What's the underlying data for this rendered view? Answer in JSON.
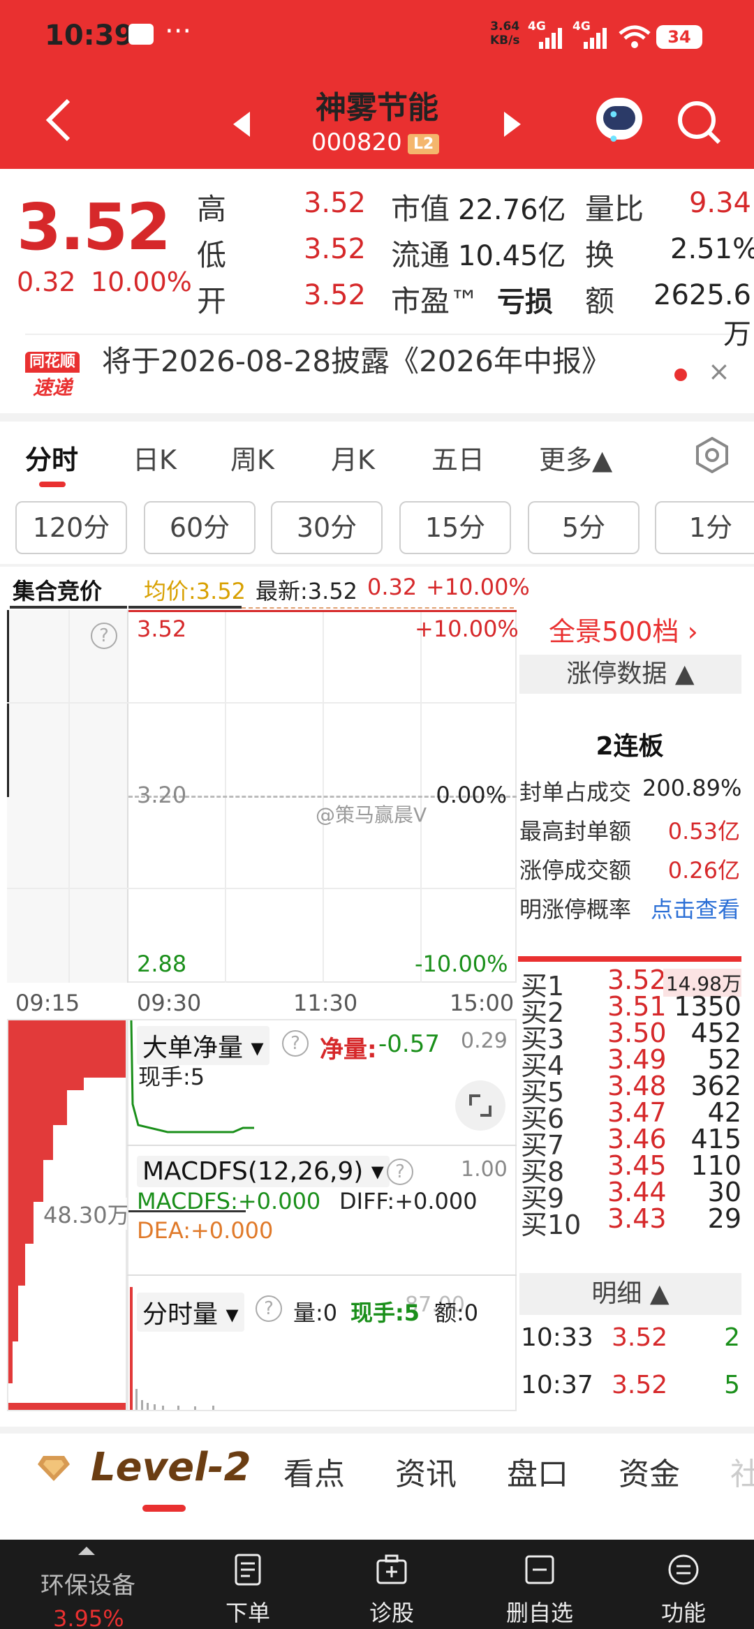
{
  "status": {
    "time": "10:39",
    "net_speed_top": "3.64",
    "net_speed_bottom": "KB/s",
    "signal_a": "4G",
    "signal_b": "4G",
    "battery": "34",
    "dots": "···"
  },
  "header": {
    "title": "神雾节能",
    "code": "000820",
    "badge": "L2"
  },
  "quote": {
    "price": "3.52",
    "change": "0.32",
    "change_pct": "10.00%",
    "high_label": "高",
    "high": "3.52",
    "low_label": "低",
    "low": "3.52",
    "open_label": "开",
    "open": "3.52",
    "mktcap_label": "市值",
    "mktcap": "22.76亿",
    "float_label": "流通",
    "float": "10.45亿",
    "pe_label": "市盈™",
    "pe": "亏损",
    "volratio_label": "量比",
    "volratio": "9.34",
    "turnover_label": "换",
    "turnover": "2.51%",
    "amount_label": "额",
    "amount": "2625.6万"
  },
  "news": {
    "logo_top": "同花顺",
    "logo_bottom": "速递",
    "text": "将于2026-08-28披露《2026年中报》",
    "close": "×"
  },
  "tabs": [
    {
      "label": "分时"
    },
    {
      "label": "日K"
    },
    {
      "label": "周K"
    },
    {
      "label": "月K"
    },
    {
      "label": "五日"
    },
    {
      "label": "更多▲"
    }
  ],
  "periods": [
    "120分",
    "60分",
    "30分",
    "15分",
    "5分",
    "1分"
  ],
  "info": {
    "auction": "集合竞价",
    "avg": "均价:3.52",
    "latest": "最新:3.52",
    "chg": "0.32",
    "chg_pct": "+10.00%"
  },
  "chart": {
    "y_top": "3.52",
    "y_mid": "3.20",
    "y_bot": "2.88",
    "pct_top": "+10.00%",
    "pct_mid": "0.00%",
    "pct_bot": "-10.00%",
    "t0": "09:15",
    "t1": "09:30",
    "t2": "11:30",
    "t3": "15:00",
    "watermark": "@策马赢晨V",
    "help": "?",
    "auction_vol": "48.30万",
    "colors": {
      "up": "#d6282a",
      "down": "#1a8f1a",
      "avg": "#e0a000"
    }
  },
  "sub1": {
    "title": "大单净量 ▾",
    "net_label": "净量:",
    "net": "-0.57",
    "right": "0.29",
    "now": "现手:5"
  },
  "sub2": {
    "title": "MACDFS(12,26,9) ▾",
    "macd": "MACDFS:+0.000",
    "diff": "DIFF:+0.000",
    "dea": "DEA:+0.000",
    "right": "1.00"
  },
  "sub3": {
    "title": "分时量 ▾",
    "vol": "量:0",
    "hand": "现手:5",
    "amt": "额:0",
    "right": "87.00"
  },
  "right_panel": {
    "depth": "全景500档 ›",
    "limit_head": "涨停数据 ▲",
    "streak": "2连板",
    "rows": [
      {
        "label": "封单占成交",
        "value": "200.89%"
      },
      {
        "label": "最高封单额",
        "value": "0.53亿"
      },
      {
        "label": "涨停成交额",
        "value": "0.26亿"
      },
      {
        "label": "明涨停概率",
        "value": "点击查看"
      }
    ]
  },
  "orderbook": [
    {
      "label": "买1",
      "price": "3.52",
      "vol": "14.98万"
    },
    {
      "label": "买2",
      "price": "3.51",
      "vol": "1350"
    },
    {
      "label": "买3",
      "price": "3.50",
      "vol": "452"
    },
    {
      "label": "买4",
      "price": "3.49",
      "vol": "52"
    },
    {
      "label": "买5",
      "price": "3.48",
      "vol": "362"
    },
    {
      "label": "买6",
      "price": "3.47",
      "vol": "42"
    },
    {
      "label": "买7",
      "price": "3.46",
      "vol": "415"
    },
    {
      "label": "买8",
      "price": "3.45",
      "vol": "110"
    },
    {
      "label": "买9",
      "price": "3.44",
      "vol": "30"
    },
    {
      "label": "买10",
      "price": "3.43",
      "vol": "29"
    }
  ],
  "detail": {
    "head": "明细 ▲",
    "rows": [
      {
        "time": "10:33",
        "price": "3.52",
        "vol": "2"
      },
      {
        "time": "10:37",
        "price": "3.52",
        "vol": "5"
      }
    ]
  },
  "bottom_tabs": [
    "Level-2",
    "看点",
    "资讯",
    "盘口",
    "资金",
    "社"
  ],
  "nav": {
    "sector": "环保设备",
    "sector_pct": "3.95%",
    "items": [
      "下单",
      "诊股",
      "删自选",
      "功能"
    ]
  }
}
